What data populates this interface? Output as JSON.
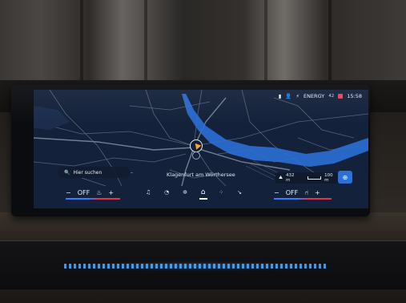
{
  "status_bar": {
    "energy_label": "ENERGY",
    "battery": "42",
    "time": "15:58",
    "icons": [
      "phone-icon",
      "person-icon",
      "energy-icon",
      "battery-icon",
      "notification-icon"
    ]
  },
  "map": {
    "search_label": "Hier suchen",
    "city_label": "Klagenfurt am Wörthersee",
    "scale_altitude": "432 m",
    "scale_distance": "100 m",
    "colors": {
      "background": "#13213a",
      "water": "#2c6fd6",
      "roads": "#5f6b80"
    }
  },
  "climate_left": {
    "minus": "−",
    "value": "OFF",
    "plus": "+",
    "icon": "seat-heat-icon"
  },
  "climate_right": {
    "minus": "−",
    "value": "OFF",
    "plus": "+",
    "icon": "seat-icon"
  },
  "dock": {
    "items": [
      "music-icon",
      "speedometer-icon",
      "fan-icon",
      "home-icon",
      "grid-icon",
      "phone-icon"
    ],
    "active": "home-icon"
  }
}
